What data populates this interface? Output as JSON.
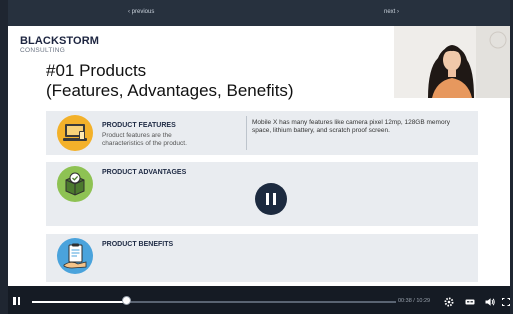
{
  "nav": {
    "previous_label": "‹ previous",
    "next_label": "next ›"
  },
  "brand": {
    "name": "BLACKSTORM",
    "sub": "CONSULTING"
  },
  "slide": {
    "title_line1": "#01 Products",
    "title_line2": "(Features, Advantages, Benefits)",
    "rows": [
      {
        "title": "PRODUCT FEATURES",
        "description": "Product features are the characteristics of the product.",
        "example": "Mobile X has many features like camera pixel 12mp, 128GB memory space, lithium battery, and scratch proof screen.",
        "icon": "laptop-devices-icon",
        "color": "#f3b12a"
      },
      {
        "title": "PRODUCT ADVANTAGES",
        "icon": "box-checkmark-icon",
        "color": "#8ec253"
      },
      {
        "title": "PRODUCT BENEFITS",
        "icon": "clipboard-hand-icon",
        "color": "#4aa3dc"
      }
    ]
  },
  "player": {
    "time": "00:38 / 10:29",
    "progress": 0.26,
    "icons": [
      "pause-icon",
      "settings-icon",
      "captions-icon",
      "volume-icon",
      "fullscreen-icon"
    ]
  }
}
